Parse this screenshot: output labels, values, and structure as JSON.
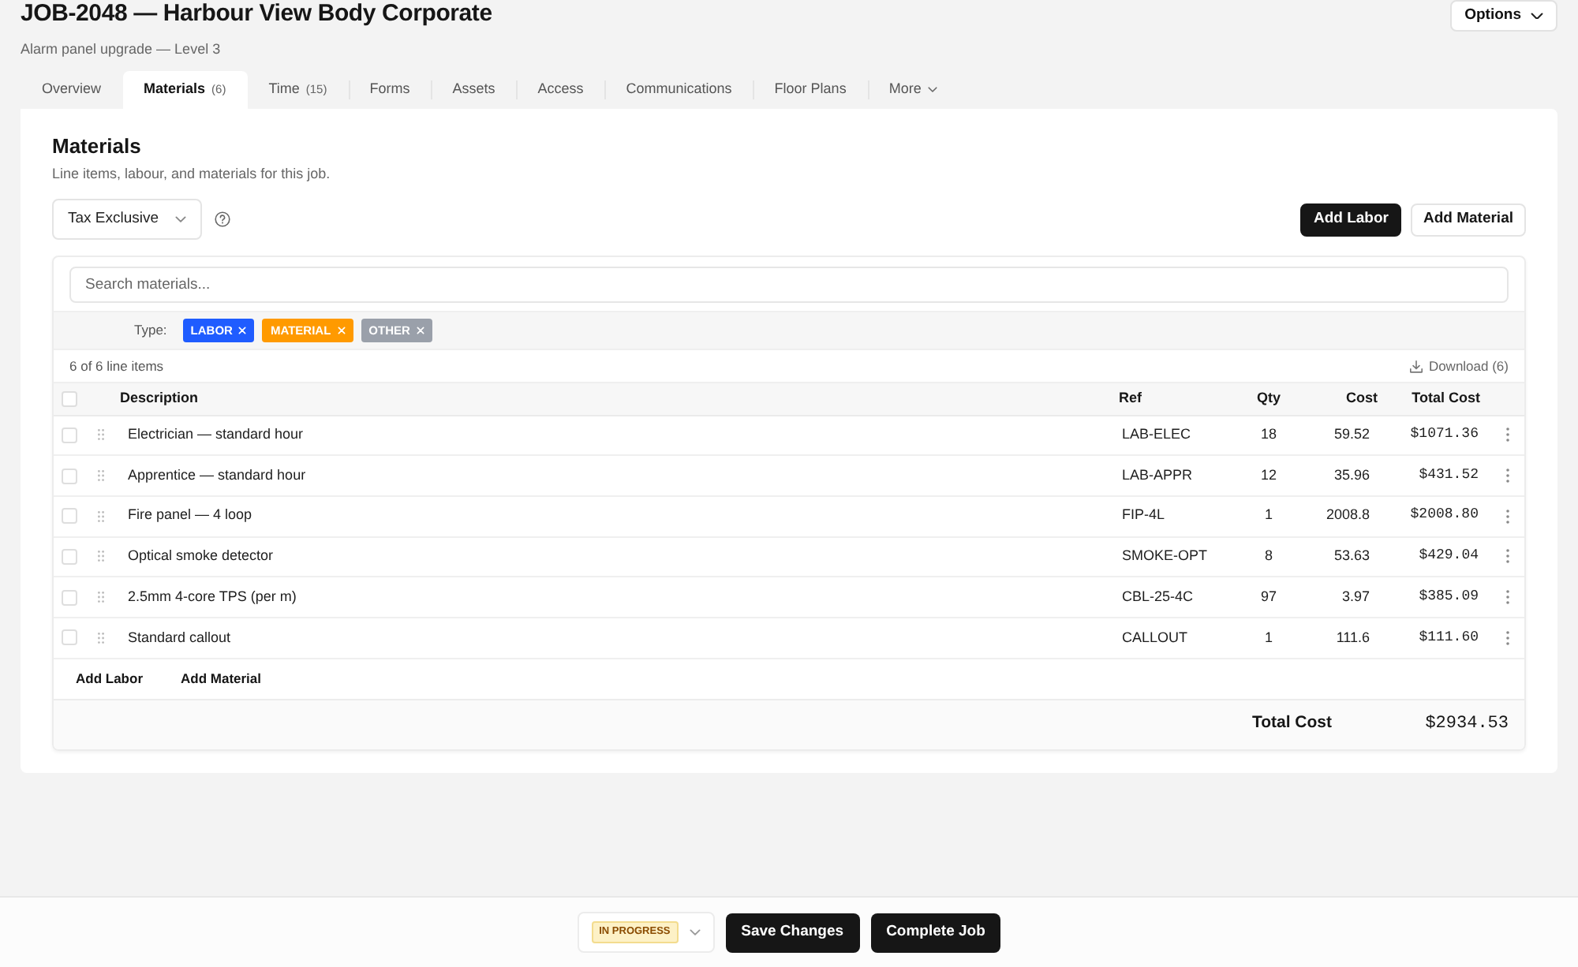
{
  "header": {
    "title": "JOB-2048 — Harbour View Body Corporate",
    "subtitle": "Alarm panel upgrade — Level 3",
    "options_button": "Options"
  },
  "tabs": [
    {
      "label": "Overview",
      "kind": "tab",
      "selected": false
    },
    {
      "label": "Materials",
      "count": "(6)",
      "kind": "tab",
      "selected": true
    },
    {
      "label": "Time",
      "count": "(15)",
      "kind": "tab",
      "selected": false
    },
    {
      "label": "Forms",
      "kind": "tab",
      "selected": false
    },
    {
      "label": "Assets",
      "kind": "tab",
      "selected": false
    },
    {
      "label": "Access",
      "kind": "tab",
      "selected": false
    },
    {
      "label": "Communications",
      "kind": "tab",
      "selected": false
    },
    {
      "label": "Floor Plans",
      "kind": "tab",
      "selected": false
    },
    {
      "label": "More",
      "kind": "menu",
      "selected": false
    }
  ],
  "section": {
    "title": "Materials",
    "description": "Line items, labour, and materials for this job.",
    "tax_select": {
      "value": "Tax Exclusive"
    },
    "buttons": [
      {
        "label": "Add Labor",
        "kind": "primary"
      },
      {
        "label": "Add Material",
        "kind": "secondary"
      }
    ]
  },
  "table": {
    "search": {
      "placeholder": "Search materials..."
    },
    "filter_label": "Type:",
    "filters": [
      {
        "label": "LABOR",
        "color": "#1f5cff"
      },
      {
        "label": "MATERIAL",
        "color": "#ff9a00"
      },
      {
        "label": "OTHER",
        "color": "#9aa0aa"
      }
    ],
    "count": "6 of 6 line items",
    "download": "Download (6)",
    "all_checked": false,
    "columns": [
      "Description",
      "Ref",
      "Qty",
      "Cost",
      "Total Cost"
    ],
    "rows": [
      {
        "checked": false,
        "description": "Electrician — standard hour",
        "ref": "LAB-ELEC",
        "qty": "18",
        "cost": "59.52",
        "total_cost": "$1071.36"
      },
      {
        "checked": false,
        "description": "Apprentice — standard hour",
        "ref": "LAB-APPR",
        "qty": "12",
        "cost": "35.96",
        "total_cost": "$431.52"
      },
      {
        "checked": false,
        "description": "Fire panel — 4 loop",
        "ref": "FIP-4L",
        "qty": "1",
        "cost": "2008.8",
        "total_cost": "$2008.80"
      },
      {
        "checked": false,
        "description": "Optical smoke detector",
        "ref": "SMOKE-OPT",
        "qty": "8",
        "cost": "53.63",
        "total_cost": "$429.04"
      },
      {
        "checked": false,
        "description": "2.5mm 4-core TPS (per m)",
        "ref": "CBL-25-4C",
        "qty": "97",
        "cost": "3.97",
        "total_cost": "$385.09"
      },
      {
        "checked": false,
        "description": "Standard callout",
        "ref": "CALLOUT",
        "qty": "1",
        "cost": "111.6",
        "total_cost": "$111.60"
      }
    ],
    "add_buttons": [
      "Add Labor",
      "Add Material"
    ],
    "total": {
      "label": "Total Cost",
      "value": "$2934.53"
    }
  },
  "footer": {
    "status": {
      "label": "IN PROGRESS"
    },
    "buttons": [
      "Save Changes",
      "Complete Job"
    ]
  }
}
